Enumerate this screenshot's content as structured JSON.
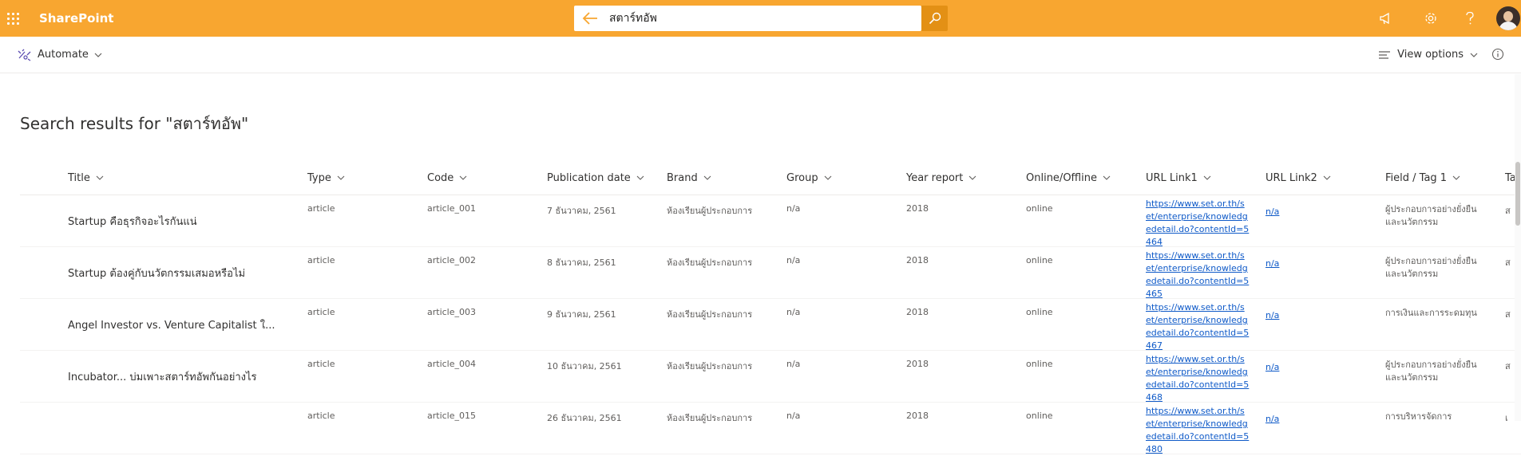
{
  "suitebar": {
    "app_name": "SharePoint",
    "search_value": "สตาร์ทอัพ",
    "bg_color": "#f8a630"
  },
  "commandbar": {
    "automate_label": "Automate",
    "view_options_label": "View options"
  },
  "page": {
    "title": "Search results for \"สตาร์ทอัพ\""
  },
  "columns": [
    "Title",
    "Type",
    "Code",
    "Publication date",
    "Brand",
    "Group",
    "Year report",
    "Online/Offline",
    "URL Link1",
    "URL Link2",
    "Field / Tag 1",
    "Ta"
  ],
  "rows": [
    {
      "title": "Startup คือธุรกิจอะไรกันแน่",
      "type": "article",
      "code": "article_001",
      "pubdate": "7 ธันวาคม, 2561",
      "brand": "ห้องเรียนผู้ประกอบการ",
      "group": "n/a",
      "year": "2018",
      "online": "online",
      "url1": "https://www.set.or.th/set/enterprise/knowledgedetail.do?contentId=5464",
      "url2": "n/a",
      "field": "ผู้ประกอบการอย่างยั่งยืนและนวัตกรรม",
      "tag": "ส"
    },
    {
      "title": "Startup ต้องคู่กับนวัตกรรมเสมอหรือไม่",
      "type": "article",
      "code": "article_002",
      "pubdate": "8 ธันวาคม, 2561",
      "brand": "ห้องเรียนผู้ประกอบการ",
      "group": "n/a",
      "year": "2018",
      "online": "online",
      "url1": "https://www.set.or.th/set/enterprise/knowledgedetail.do?contentId=5465",
      "url2": "n/a",
      "field": "ผู้ประกอบการอย่างยั่งยืนและนวัตกรรม",
      "tag": "ส"
    },
    {
      "title": "Angel Investor vs. Venture Capitalist ใ...",
      "type": "article",
      "code": "article_003",
      "pubdate": "9 ธันวาคม, 2561",
      "brand": "ห้องเรียนผู้ประกอบการ",
      "group": "n/a",
      "year": "2018",
      "online": "online",
      "url1": "https://www.set.or.th/set/enterprise/knowledgedetail.do?contentId=5467",
      "url2": "n/a",
      "field": "การเงินและการระดมทุน",
      "tag": "ส"
    },
    {
      "title": "Incubator... บ่มเพาะสตาร์ทอัพกันอย่างไร",
      "type": "article",
      "code": "article_004",
      "pubdate": "10 ธันวาคม, 2561",
      "brand": "ห้องเรียนผู้ประกอบการ",
      "group": "n/a",
      "year": "2018",
      "online": "online",
      "url1": "https://www.set.or.th/set/enterprise/knowledgedetail.do?contentId=5468",
      "url2": "n/a",
      "field": "ผู้ประกอบการอย่างยั่งยืนและนวัตกรรม",
      "tag": "ส"
    },
    {
      "title": "",
      "type": "article",
      "code": "article_015",
      "pubdate": "26 ธันวาคม, 2561",
      "brand": "ห้องเรียนผู้ประกอบการ",
      "group": "n/a",
      "year": "2018",
      "online": "online",
      "url1": "https://www.set.or.th/set/enterprise/knowledgedetail.do?contentId=5480",
      "url2": "n/a",
      "field": "การบริหารจัดการ",
      "tag": "เ"
    }
  ]
}
